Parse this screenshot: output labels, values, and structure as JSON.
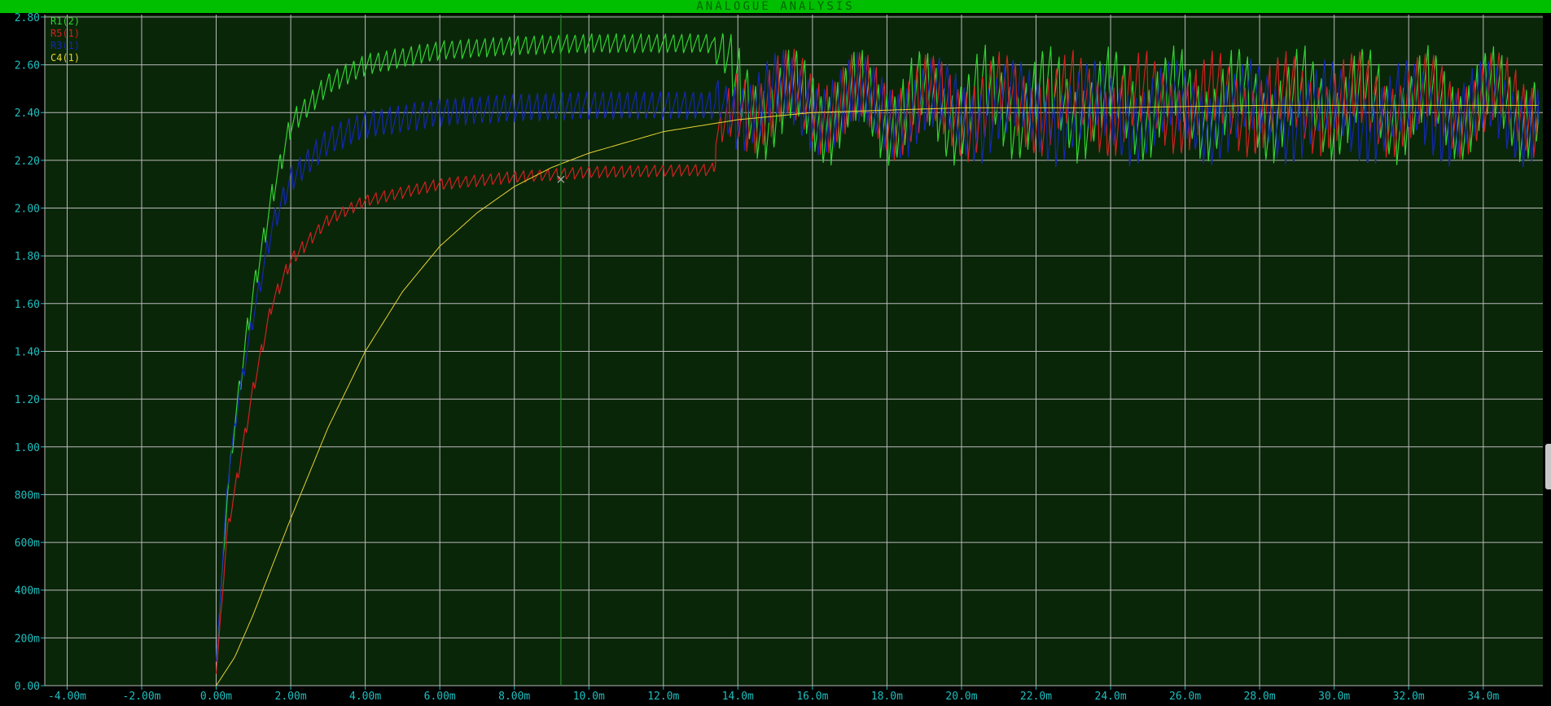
{
  "window": {
    "title": "ANALOGUE ANALYSIS"
  },
  "colors": {
    "titlebar": "#00bf00",
    "plot_background": "#0a2609",
    "grid": "#b9b9b9",
    "tick_text": "#1fbfbf",
    "cursor": "#2e8b2e"
  },
  "chart_data": {
    "type": "line",
    "grid": true,
    "legend_position": "top-left",
    "xlim": [
      -4.6,
      35.6
    ],
    "ylim": [
      0.0,
      2.81
    ],
    "x_ticks": [
      {
        "v": -4,
        "label": "-4.00m"
      },
      {
        "v": -2,
        "label": "-2.00m"
      },
      {
        "v": 0,
        "label": "0.00m"
      },
      {
        "v": 2,
        "label": "2.00m"
      },
      {
        "v": 4,
        "label": "4.00m"
      },
      {
        "v": 6,
        "label": "6.00m"
      },
      {
        "v": 8,
        "label": "8.00m"
      },
      {
        "v": 10,
        "label": "10.0m"
      },
      {
        "v": 12,
        "label": "12.0m"
      },
      {
        "v": 14,
        "label": "14.0m"
      },
      {
        "v": 16,
        "label": "16.0m"
      },
      {
        "v": 18,
        "label": "18.0m"
      },
      {
        "v": 20,
        "label": "20.0m"
      },
      {
        "v": 22,
        "label": "22.0m"
      },
      {
        "v": 24,
        "label": "24.0m"
      },
      {
        "v": 26,
        "label": "26.0m"
      },
      {
        "v": 28,
        "label": "28.0m"
      },
      {
        "v": 30,
        "label": "30.0m"
      },
      {
        "v": 32,
        "label": "32.0m"
      },
      {
        "v": 34,
        "label": "34.0m"
      }
    ],
    "y_ticks": [
      {
        "v": 0.0,
        "label": "0.00"
      },
      {
        "v": 0.2,
        "label": "200m"
      },
      {
        "v": 0.4,
        "label": "400m"
      },
      {
        "v": 0.6,
        "label": "600m"
      },
      {
        "v": 0.8,
        "label": "800m"
      },
      {
        "v": 1.0,
        "label": "1.00"
      },
      {
        "v": 1.2,
        "label": "1.20"
      },
      {
        "v": 1.4,
        "label": "1.40"
      },
      {
        "v": 1.6,
        "label": "1.60"
      },
      {
        "v": 1.8,
        "label": "1.80"
      },
      {
        "v": 2.0,
        "label": "2.00"
      },
      {
        "v": 2.2,
        "label": "2.20"
      },
      {
        "v": 2.4,
        "label": "2.40"
      },
      {
        "v": 2.6,
        "label": "2.60"
      },
      {
        "v": 2.8,
        "label": "2.80"
      }
    ],
    "cursor": {
      "x": 9.25,
      "y": 2.12
    },
    "series": [
      {
        "name": "R1(2)",
        "color": "#32d232",
        "width": 1.2,
        "x": [
          0.0,
          0.3,
          0.5,
          0.8,
          1.0,
          1.5,
          2.0,
          3.0,
          4.0,
          6.0,
          8.0,
          10.0,
          13.3,
          14.0,
          16.0,
          18.0,
          20.0,
          22.0,
          24.0,
          26.0,
          28.0,
          30.0,
          32.0,
          35.5
        ],
        "y": [
          0.1,
          0.8,
          1.1,
          1.45,
          1.65,
          2.05,
          2.35,
          2.52,
          2.6,
          2.66,
          2.68,
          2.69,
          2.69,
          2.45,
          2.42,
          2.42,
          2.43,
          2.44,
          2.43,
          2.44,
          2.43,
          2.44,
          2.43,
          2.44
        ],
        "ripple": [
          0.0,
          0.06,
          0.08,
          0.1,
          0.1,
          0.1,
          0.1,
          0.09,
          0.09,
          0.08,
          0.08,
          0.08,
          0.08,
          0.3,
          0.3,
          0.3,
          0.3,
          0.3,
          0.3,
          0.3,
          0.3,
          0.3,
          0.3,
          0.3
        ],
        "period": 0.22,
        "osc_start": 13.4,
        "osc_period": 1.7,
        "osc_amp": 0.1,
        "phase": 0.0
      },
      {
        "name": "R5(1)",
        "color": "#d22020",
        "width": 1.2,
        "x": [
          0.0,
          0.3,
          0.6,
          1.0,
          1.5,
          2.0,
          3.0,
          4.0,
          6.0,
          8.0,
          10.0,
          13.3,
          14.0,
          16.0,
          18.0,
          20.0,
          22.0,
          24.0,
          26.0,
          28.0,
          30.0,
          32.0,
          35.5
        ],
        "y": [
          0.05,
          0.65,
          0.9,
          1.25,
          1.6,
          1.78,
          1.95,
          2.03,
          2.1,
          2.13,
          2.15,
          2.16,
          2.45,
          2.45,
          2.43,
          2.42,
          2.44,
          2.43,
          2.44,
          2.43,
          2.44,
          2.43,
          2.44
        ],
        "ripple": [
          0.0,
          0.05,
          0.06,
          0.06,
          0.06,
          0.06,
          0.05,
          0.05,
          0.05,
          0.05,
          0.05,
          0.05,
          0.3,
          0.3,
          0.3,
          0.3,
          0.3,
          0.3,
          0.3,
          0.3,
          0.3,
          0.3,
          0.3
        ],
        "period": 0.22,
        "osc_start": 13.4,
        "osc_period": 1.9,
        "osc_amp": 0.08,
        "phase": 1.3
      },
      {
        "name": "R3(1)",
        "color": "#1428b4",
        "width": 1.2,
        "x": [
          0.0,
          0.3,
          0.6,
          1.0,
          1.5,
          2.0,
          3.0,
          4.0,
          6.0,
          8.0,
          10.0,
          13.3,
          14.0,
          16.0,
          18.0,
          20.0,
          22.0,
          24.0,
          26.0,
          28.0,
          30.0,
          32.0,
          35.5
        ],
        "y": [
          0.1,
          0.85,
          1.2,
          1.55,
          1.92,
          2.12,
          2.28,
          2.35,
          2.4,
          2.42,
          2.43,
          2.43,
          2.45,
          2.44,
          2.42,
          2.41,
          2.4,
          2.4,
          2.4,
          2.4,
          2.4,
          2.4,
          2.4
        ],
        "ripple": [
          0.0,
          0.05,
          0.07,
          0.08,
          0.1,
          0.11,
          0.12,
          0.12,
          0.12,
          0.12,
          0.12,
          0.12,
          0.28,
          0.3,
          0.3,
          0.3,
          0.3,
          0.3,
          0.3,
          0.3,
          0.3,
          0.3,
          0.3
        ],
        "period": 0.22,
        "osc_start": 13.4,
        "osc_period": 2.1,
        "osc_amp": 0.08,
        "phase": 2.6
      },
      {
        "name": "C4(1)",
        "color": "#e6d232",
        "width": 1.0,
        "x": [
          0.0,
          0.5,
          1.0,
          1.5,
          2.0,
          3.0,
          4.0,
          5.0,
          6.0,
          7.0,
          8.0,
          9.0,
          10.0,
          12.0,
          14.0,
          16.0,
          18.0,
          20.0,
          24.0,
          28.0,
          32.0,
          35.5
        ],
        "y": [
          0.0,
          0.12,
          0.3,
          0.5,
          0.7,
          1.08,
          1.4,
          1.65,
          1.84,
          1.98,
          2.09,
          2.17,
          2.23,
          2.32,
          2.37,
          2.4,
          2.41,
          2.42,
          2.42,
          2.43,
          2.43,
          2.43
        ],
        "ripple": [
          0,
          0,
          0,
          0,
          0,
          0,
          0,
          0,
          0,
          0,
          0,
          0,
          0,
          0,
          0,
          0,
          0,
          0,
          0,
          0,
          0,
          0
        ],
        "period": 1,
        "osc_start": 99,
        "osc_period": 1,
        "osc_amp": 0,
        "phase": 0
      }
    ]
  }
}
